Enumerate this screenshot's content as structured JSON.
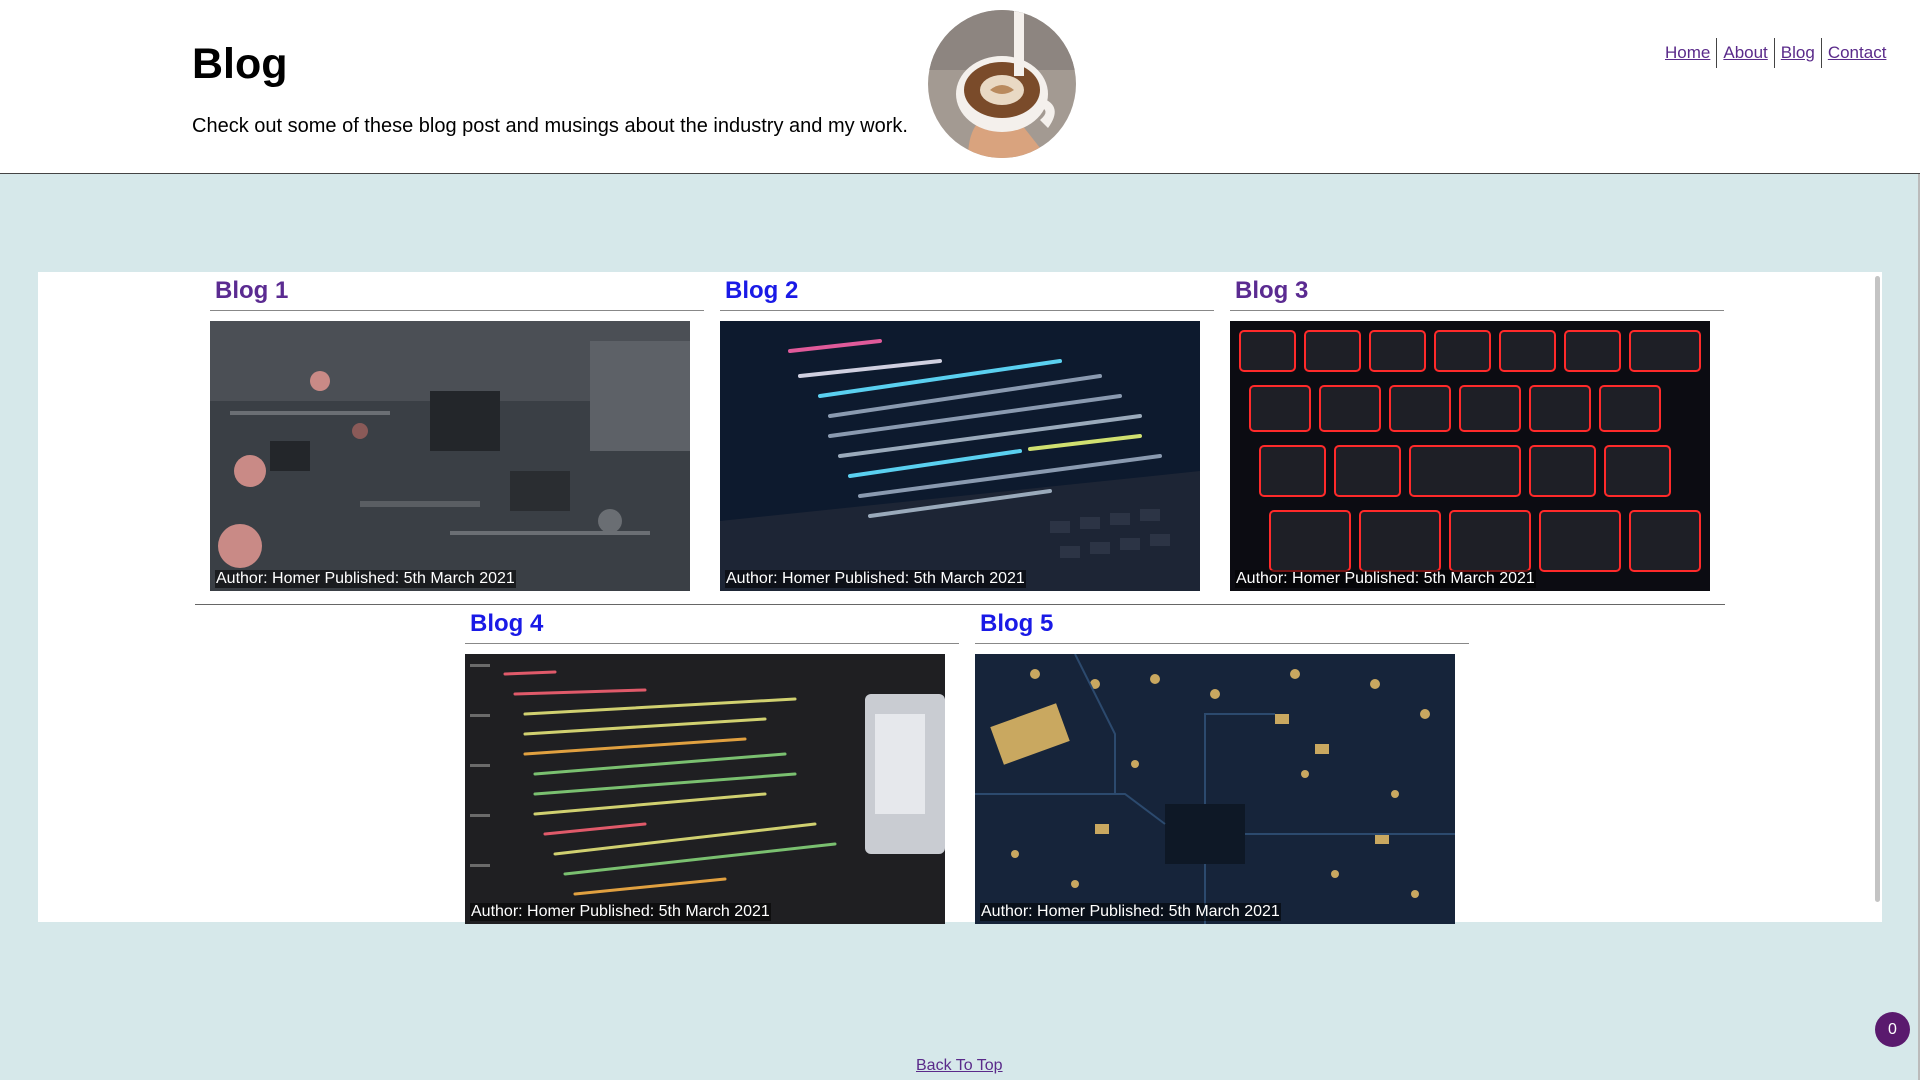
{
  "header": {
    "title": "Blog",
    "intro": "Check out some of these blog post and musings about the industry and my work.",
    "avatar_icon": "coffee-latte-photo"
  },
  "nav": {
    "items": [
      {
        "label": "Home"
      },
      {
        "label": "About"
      },
      {
        "label": "Blog"
      },
      {
        "label": "Contact"
      }
    ]
  },
  "posts": [
    {
      "title": "Blog 1",
      "caption": "Author: Homer Published: 5th March 2021",
      "image": "circuit-board-photo"
    },
    {
      "title": "Blog 2",
      "caption": "Author: Homer Published: 5th March 2021",
      "image": "laptop-code-photo"
    },
    {
      "title": "Blog 3",
      "caption": "Author: Homer Published: 5th March 2021",
      "image": "red-keyboard-photo"
    },
    {
      "title": "Blog 4",
      "caption": "Author: Homer Published: 5th March 2021",
      "image": "html-code-photo"
    },
    {
      "title": "Blog 5",
      "caption": "Author: Homer Published: 5th March 2021",
      "image": "blue-pcb-photo"
    }
  ],
  "footer": {
    "back_to_top": "Back To Top",
    "badge_count": "0"
  },
  "colors": {
    "background": "#d6e8ea",
    "visited_link": "#5b2b91",
    "link": "#1a1ae6",
    "badge": "#5a1a6e"
  }
}
